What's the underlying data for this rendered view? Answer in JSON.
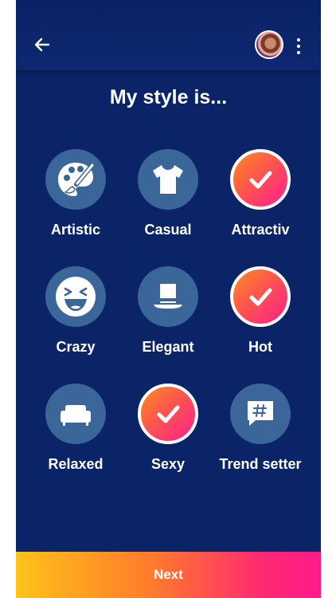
{
  "header": {
    "back_icon": "arrow-left-icon",
    "avatar_icon": "user-avatar",
    "menu_icon": "more-vertical-icon"
  },
  "title": "My style is...",
  "styles": [
    {
      "label": "Artistic",
      "icon": "palette-icon",
      "selected": false
    },
    {
      "label": "Casual",
      "icon": "tshirt-icon",
      "selected": false
    },
    {
      "label": "Attractiv",
      "icon": "check-icon",
      "selected": true
    },
    {
      "label": "Crazy",
      "icon": "laughing-face-icon",
      "selected": false
    },
    {
      "label": "Elegant",
      "icon": "top-hat-icon",
      "selected": false
    },
    {
      "label": "Hot",
      "icon": "check-icon",
      "selected": true
    },
    {
      "label": "Relaxed",
      "icon": "sofa-icon",
      "selected": false
    },
    {
      "label": "Sexy",
      "icon": "check-icon",
      "selected": true
    },
    {
      "label": "Trend setter",
      "icon": "hashtag-chat-icon",
      "selected": false
    }
  ],
  "next_label": "Next",
  "colors": {
    "background": "#0b2468",
    "circle": "#3b6699",
    "selected_gradient_start": "#ff8a1c",
    "selected_gradient_end": "#ff1f8e",
    "next_gradient_start": "#ffc21a",
    "next_gradient_end": "#ff1a8a"
  }
}
